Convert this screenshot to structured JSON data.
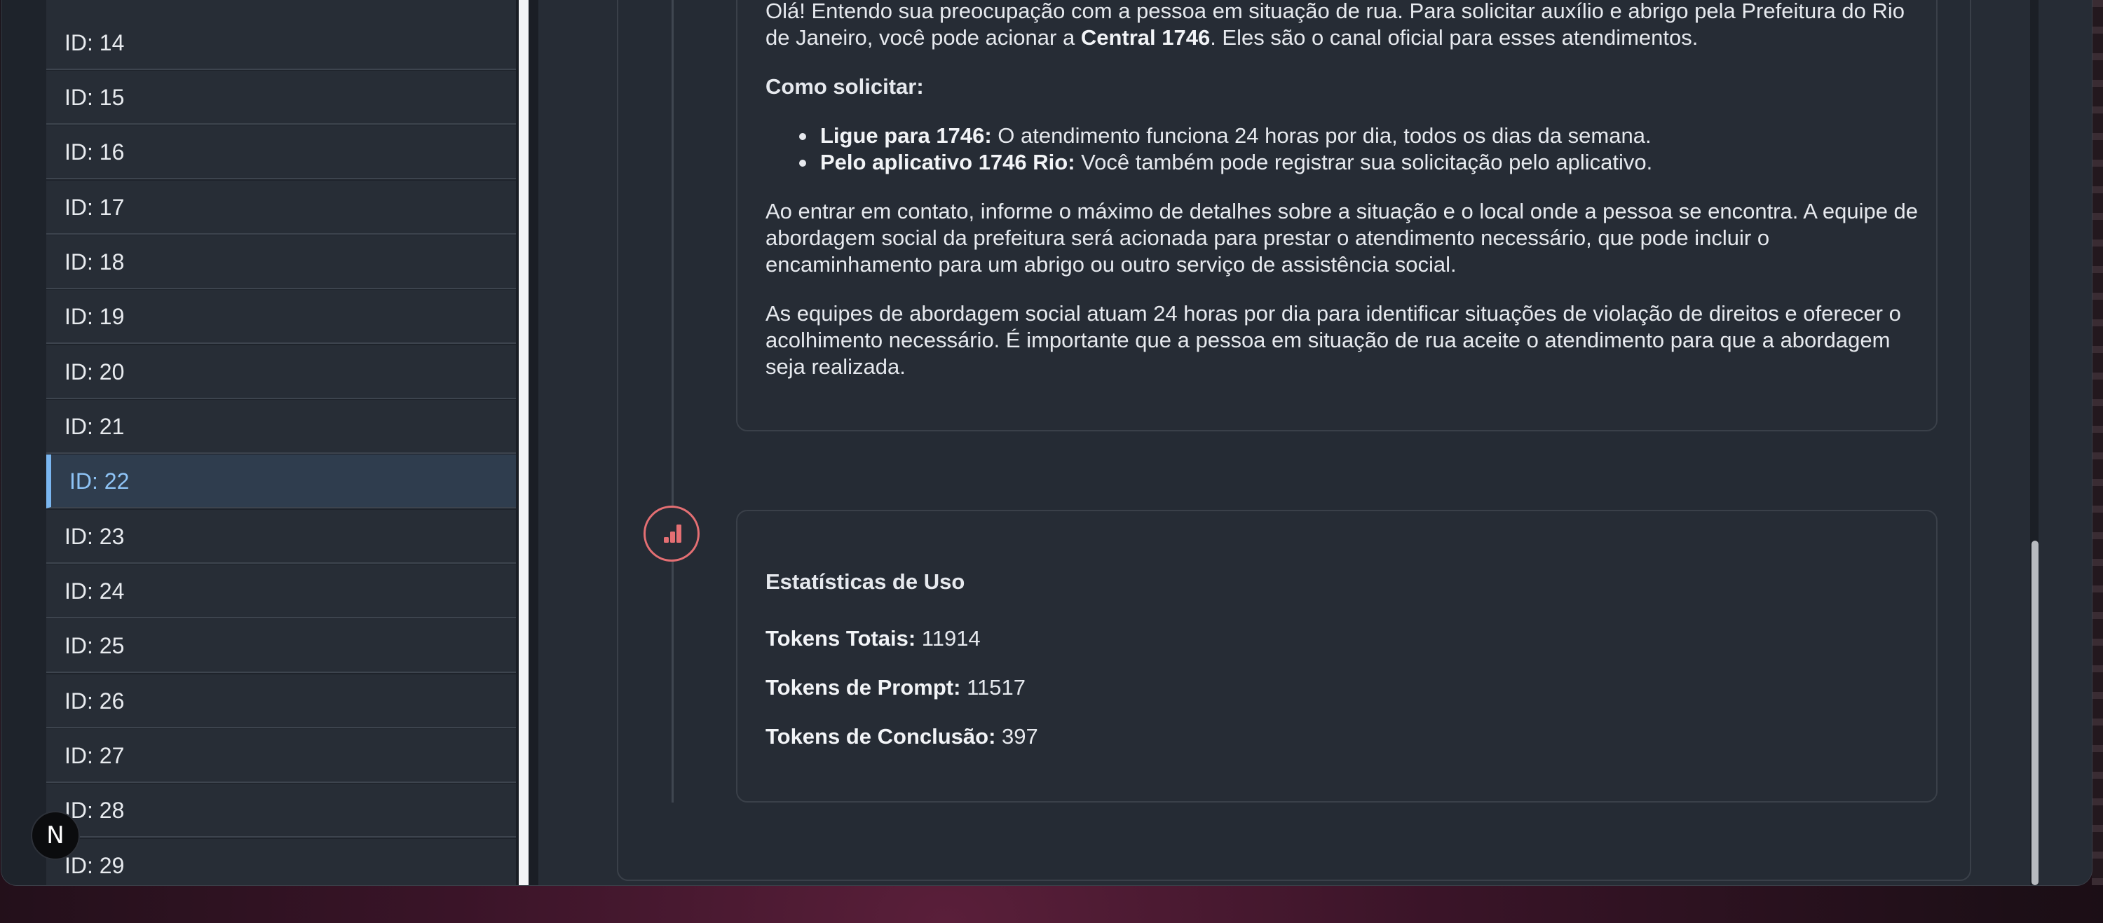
{
  "sidebar": {
    "items": [
      {
        "label": "ID: 14"
      },
      {
        "label": "ID: 15"
      },
      {
        "label": "ID: 16"
      },
      {
        "label": "ID: 17"
      },
      {
        "label": "ID: 18"
      },
      {
        "label": "ID: 19"
      },
      {
        "label": "ID: 20"
      },
      {
        "label": "ID: 21"
      },
      {
        "label": "ID: 22"
      },
      {
        "label": "ID: 23"
      },
      {
        "label": "ID: 24"
      },
      {
        "label": "ID: 25"
      },
      {
        "label": "ID: 26"
      },
      {
        "label": "ID: 27"
      },
      {
        "label": "ID: 28"
      },
      {
        "label": "ID: 29"
      }
    ],
    "selected_label": "ID: 22"
  },
  "message": {
    "p1_a": "Olá! Entendo sua preocupação com a pessoa em situação de rua. Para solicitar auxílio e abrigo pela Prefeitura do Rio de Janeiro, você pode acionar a ",
    "p1_bold": "Central 1746",
    "p1_b": ". Eles são o canal oficial para esses atendimentos.",
    "heading": "Como solicitar:",
    "bullets": [
      {
        "bold": "Ligue para 1746:",
        "text": " O atendimento funciona 24 horas por dia, todos os dias da semana."
      },
      {
        "bold": "Pelo aplicativo 1746 Rio:",
        "text": " Você também pode registrar sua solicitação pelo aplicativo."
      }
    ],
    "p2": "Ao entrar em contato, informe o máximo de detalhes sobre a situação e o local onde a pessoa se encontra. A equipe de abordagem social da prefeitura será acionada para prestar o atendimento necessário, que pode incluir o encaminhamento para um abrigo ou outro serviço de assistência social.",
    "p3": "As equipes de abordagem social atuam 24 horas por dia para identificar situações de violação de direitos e oferecer o acolhimento necessário. É importante que a pessoa em situação de rua aceite o atendimento para que a abordagem seja realizada."
  },
  "stats": {
    "title": "Estatísticas de Uso",
    "total_label": "Tokens Totais:",
    "total_value": " 11914",
    "prompt_label": "Tokens de Prompt:",
    "prompt_value": " 11517",
    "completion_label": "Tokens de Conclusão:",
    "completion_value": " 397",
    "icon": "bar-chart-icon",
    "icon_color": "#e46f73"
  },
  "badge": {
    "label": "N"
  },
  "colors": {
    "accent": "#7ab6f0",
    "selected_bg": "#2f3d4e",
    "window_bg": "#202630"
  }
}
